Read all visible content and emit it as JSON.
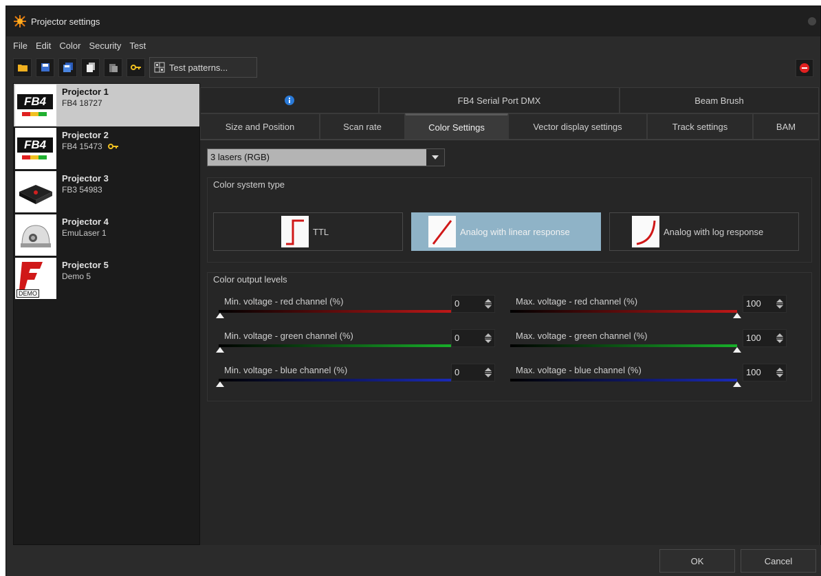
{
  "window": {
    "title": "Projector settings"
  },
  "menu": [
    "File",
    "Edit",
    "Color",
    "Security",
    "Test"
  ],
  "toolbar": {
    "icons": [
      "open-folder-icon",
      "save-icon",
      "save-all-icon",
      "copy-icon",
      "paste-icon",
      "key-icon"
    ],
    "test_patterns_label": "Test patterns...",
    "stop_icon": "stop-icon"
  },
  "projectors": [
    {
      "name": "Projector 1",
      "sub": "FB4 18727",
      "thumb": "FB4",
      "key": false,
      "selected": true
    },
    {
      "name": "Projector 2",
      "sub": "FB4 15473",
      "thumb": "FB4",
      "key": true,
      "selected": false
    },
    {
      "name": "Projector 3",
      "sub": "FB3 54983",
      "thumb": "FB3",
      "key": false,
      "selected": false
    },
    {
      "name": "Projector 4",
      "sub": "EmuLaser 1",
      "thumb": "EMU",
      "key": false,
      "selected": false
    },
    {
      "name": "Projector 5",
      "sub": "Demo 5",
      "thumb": "DEMO",
      "key": false,
      "selected": false
    }
  ],
  "thumb_labels": {
    "fb4": "FB4",
    "demo": "DEMO"
  },
  "tabs_top": [
    {
      "label": "",
      "icon": "info-icon"
    },
    {
      "label": "FB4 Serial Port DMX"
    },
    {
      "label": "Beam Brush"
    }
  ],
  "tabs_bottom": [
    {
      "label": "Size and Position"
    },
    {
      "label": "Scan rate"
    },
    {
      "label": "Color Settings",
      "active": true
    },
    {
      "label": "Vector display settings"
    },
    {
      "label": "Track settings"
    },
    {
      "label": "BAM"
    }
  ],
  "laser_config": {
    "selected": "3 lasers (RGB)"
  },
  "color_system": {
    "title": "Color system type",
    "options": [
      {
        "label": "TTL",
        "icon": "ttl-step-icon",
        "active": false
      },
      {
        "label": "Analog with linear response",
        "icon": "linear-response-icon",
        "active": true
      },
      {
        "label": "Analog with log response",
        "icon": "log-response-icon",
        "active": false
      }
    ]
  },
  "output_levels": {
    "title": "Color output levels",
    "channels": [
      {
        "min_label": "Min. voltage - red channel (%)",
        "max_label": "Max. voltage - red channel (%)",
        "min": "0",
        "max": "100",
        "color": "#c01818"
      },
      {
        "min_label": "Min. voltage - green channel (%)",
        "max_label": "Max. voltage - green channel (%)",
        "min": "0",
        "max": "100",
        "color": "#18b02a"
      },
      {
        "min_label": "Min. voltage - blue channel (%)",
        "max_label": "Max. voltage - blue channel (%)",
        "min": "0",
        "max": "100",
        "color": "#1a2ab8"
      }
    ]
  },
  "footer": {
    "ok": "OK",
    "cancel": "Cancel"
  }
}
